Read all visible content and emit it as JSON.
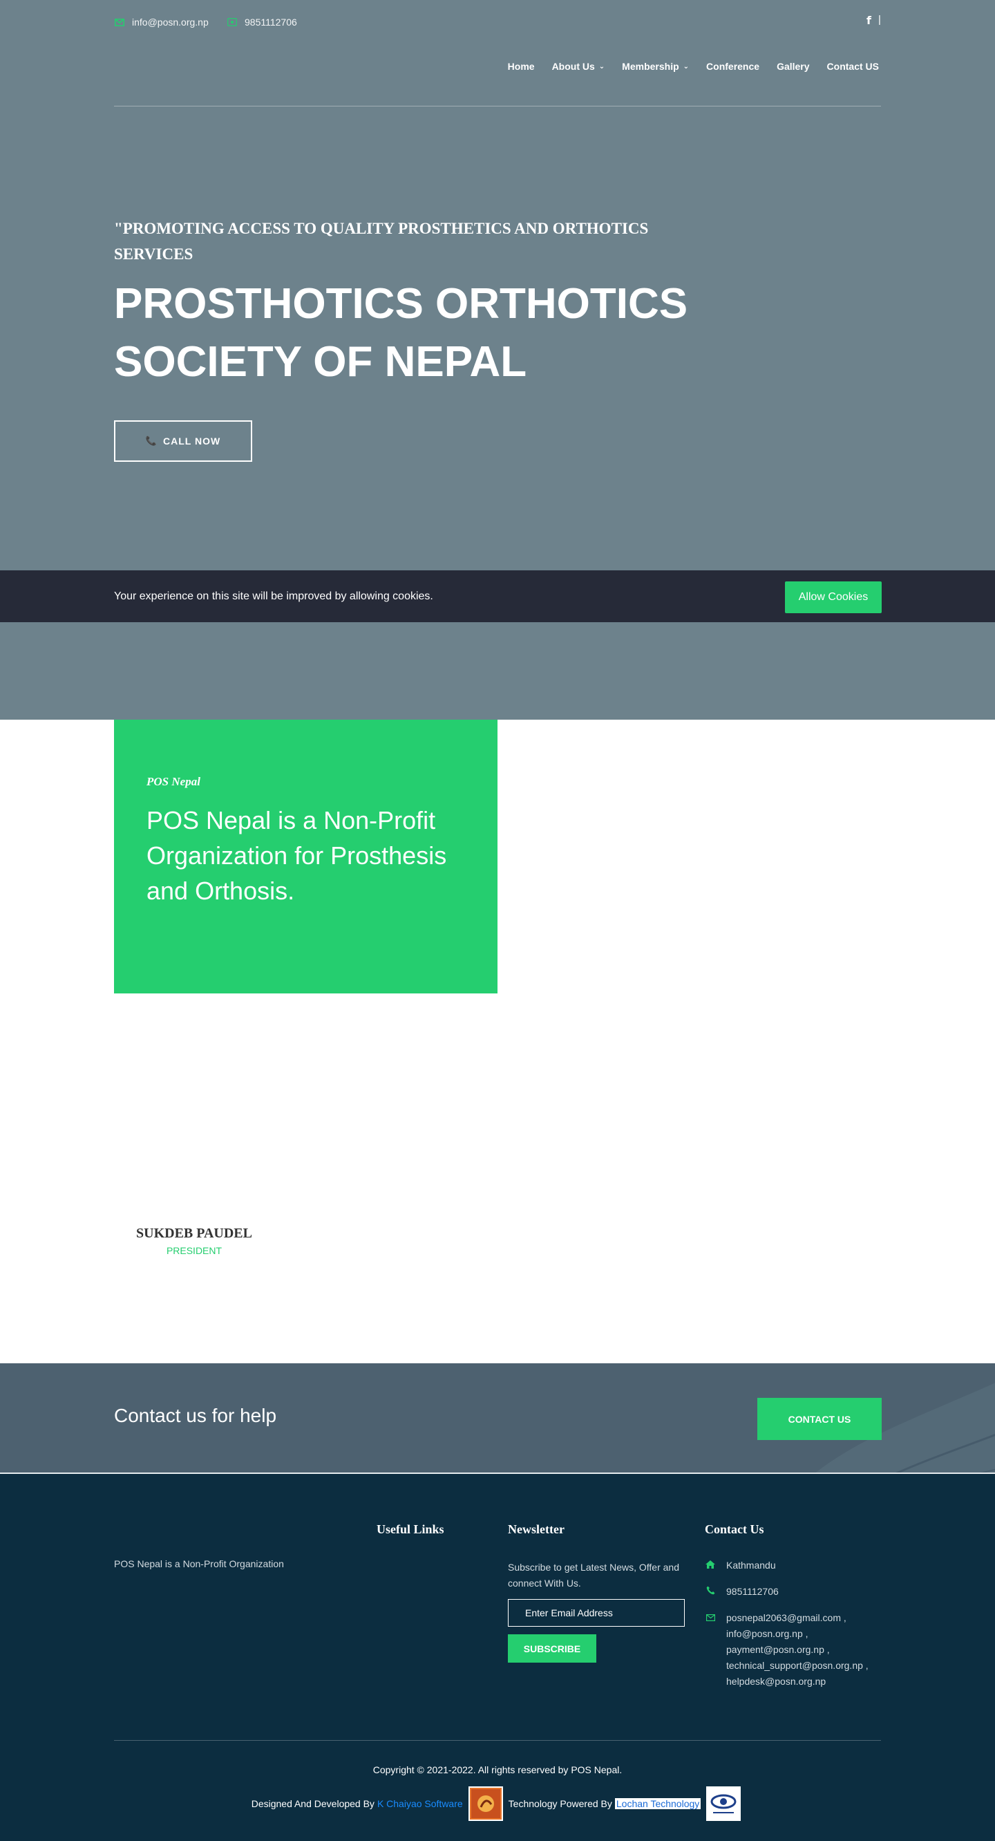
{
  "topbar": {
    "email": "info@posn.org.np",
    "phone": "9851112706",
    "social_separator": "|"
  },
  "nav": {
    "items": [
      {
        "label": "Home",
        "has_dropdown": false
      },
      {
        "label": "About Us",
        "has_dropdown": true
      },
      {
        "label": "Membership",
        "has_dropdown": true
      },
      {
        "label": "Conference",
        "has_dropdown": false
      },
      {
        "label": "Gallery",
        "has_dropdown": false
      },
      {
        "label": "Contact US",
        "has_dropdown": false
      }
    ]
  },
  "hero": {
    "tagline": "\"PROMOTING ACCESS TO QUALITY PROSTHETICS AND ORTHOTICS SERVICES",
    "title": "PROSTHOTICS ORTHOTICS SOCIETY OF NEPAL",
    "call_button": "CALL NOW"
  },
  "cookie": {
    "message": "Your experience on this site will be improved by allowing cookies.",
    "button": "Allow Cookies"
  },
  "about": {
    "kicker": "POS Nepal",
    "text": "POS Nepal is a Non-Profit Organization for Prosthesis and Orthosis."
  },
  "team": {
    "member_name": "SUKDEB PAUDEL",
    "member_role": "PRESIDENT"
  },
  "cta": {
    "text": "Contact us for help",
    "button": "CONTACT US"
  },
  "footer": {
    "about_blurb": "POS Nepal is a Non-Profit Organization",
    "useful_links_heading": "Useful Links",
    "newsletter_heading": "Newsletter",
    "newsletter_text": "Subscribe to get Latest News, Offer and connect With Us.",
    "newsletter_placeholder": "Enter Email Address",
    "subscribe_button": "SUBSCRIBE",
    "contact_heading": "Contact Us",
    "contact_location": "Kathmandu",
    "contact_phone": "9851112706",
    "contact_emails": [
      "posnepal2063@gmail.com ,",
      "info@posn.org.np ,",
      "payment@posn.org.np ,",
      "technical_support@posn.org.np ,",
      "helpdesk@posn.org.np"
    ],
    "copyright": "Copyright © 2021-2022. All rights reserved by  POS Nepal.",
    "credits_prefix": "Designed And Developed By",
    "credits_link_1": "K Chaiyao Software",
    "credits_middle": "Technology Powered By",
    "credits_link_2": "Lochan Technology"
  },
  "colors": {
    "accent": "#25ce6f",
    "hero_bg": "#6d828c",
    "cookie_bg": "#262a38",
    "cta_bg": "#4d6170",
    "footer_bg": "#0c2d40"
  },
  "icons": {
    "email": "envelope-icon",
    "phone": "phone-icon",
    "facebook": "facebook-icon",
    "location": "home-icon"
  }
}
